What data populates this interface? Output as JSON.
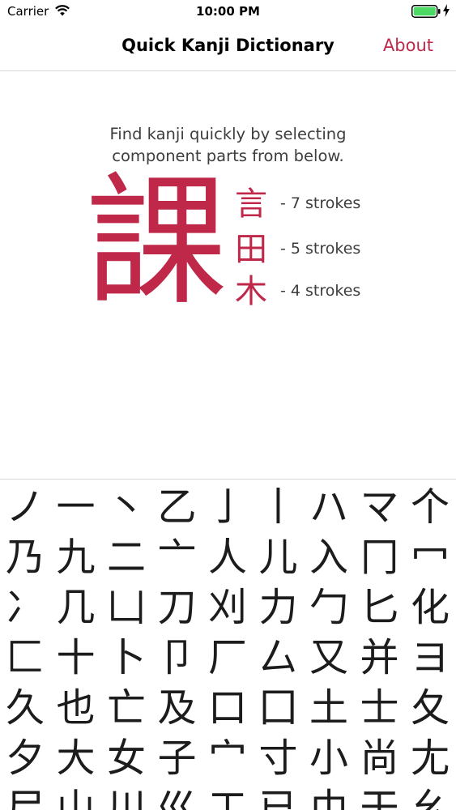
{
  "status_bar": {
    "carrier": "Carrier",
    "time": "10:00 PM"
  },
  "nav": {
    "title": "Quick Kanji Dictionary",
    "about_label": "About"
  },
  "instruction": {
    "line1": "Find kanji quickly by selecting",
    "line2": "component parts from below."
  },
  "example": {
    "kanji": "課",
    "components": [
      {
        "char": "言",
        "strokes": "- 7 strokes"
      },
      {
        "char": "田",
        "strokes": "- 5 strokes"
      },
      {
        "char": "木",
        "strokes": "- 4 strokes"
      }
    ]
  },
  "accent_color": "#c0284a",
  "radicals": [
    [
      "ノ",
      "一",
      "丶",
      "乙",
      "亅",
      "丨",
      "ハ",
      "マ",
      "个"
    ],
    [
      "乃",
      "九",
      "二",
      "亠",
      "人",
      "儿",
      "入",
      "冂",
      "冖"
    ],
    [
      "冫",
      "几",
      "凵",
      "刀",
      "刈",
      "力",
      "勹",
      "匕",
      "化"
    ],
    [
      "匚",
      "十",
      "卜",
      "卩",
      "厂",
      "厶",
      "又",
      "并",
      "ヨ"
    ],
    [
      "久",
      "也",
      "亡",
      "及",
      "口",
      "囗",
      "土",
      "士",
      "夂"
    ],
    [
      "夕",
      "大",
      "女",
      "子",
      "宀",
      "寸",
      "小",
      "尚",
      "尢"
    ],
    [
      "尸",
      "山",
      "川",
      "巛",
      "工",
      "已",
      "巾",
      "干",
      "幺"
    ]
  ]
}
